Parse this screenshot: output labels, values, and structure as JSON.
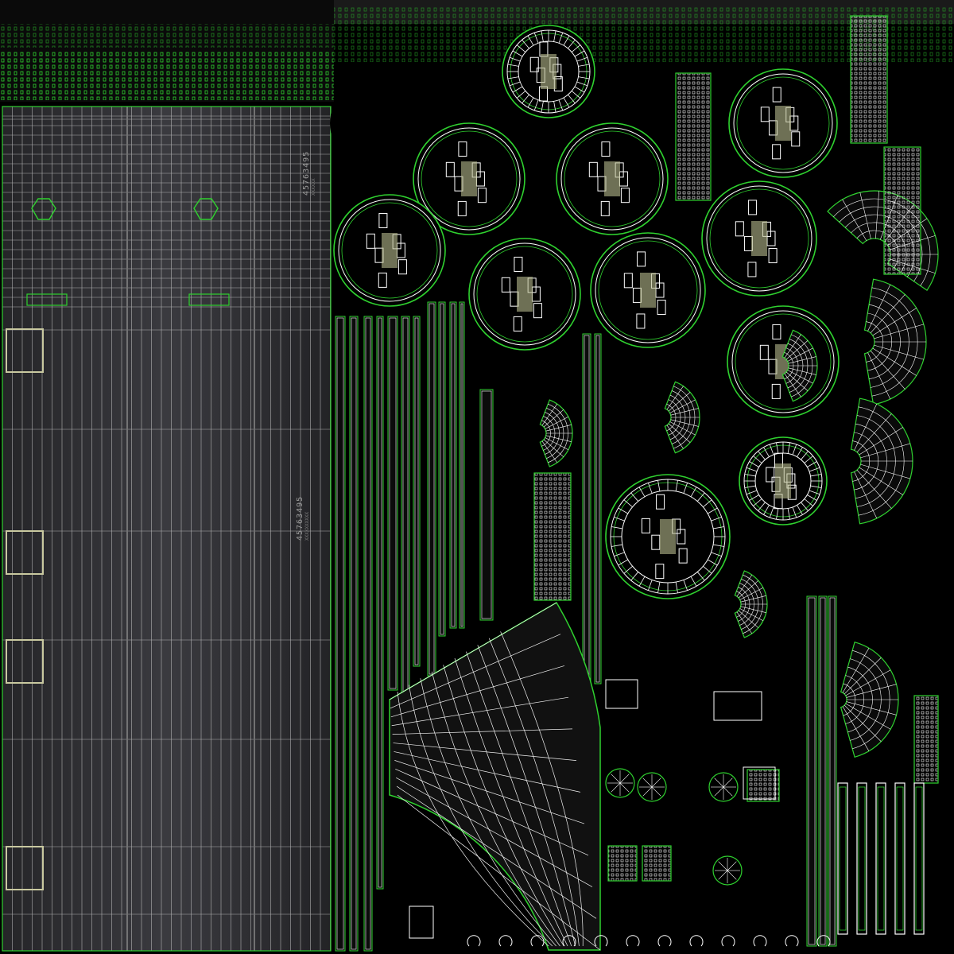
{
  "texture_sheet": {
    "serial_large": "45763495",
    "serial_large_sub": "XXXXXXXXXX",
    "serial_small": "45763495",
    "serial_small_sub": "XXXXXX"
  },
  "colors": {
    "background": "#000000",
    "wire_green": "#2fd12f",
    "wire_white": "#ffffff",
    "metal_dark": "#2e2e32",
    "metal_light": "#b9b9bb",
    "beige": "#c7c9a0"
  }
}
